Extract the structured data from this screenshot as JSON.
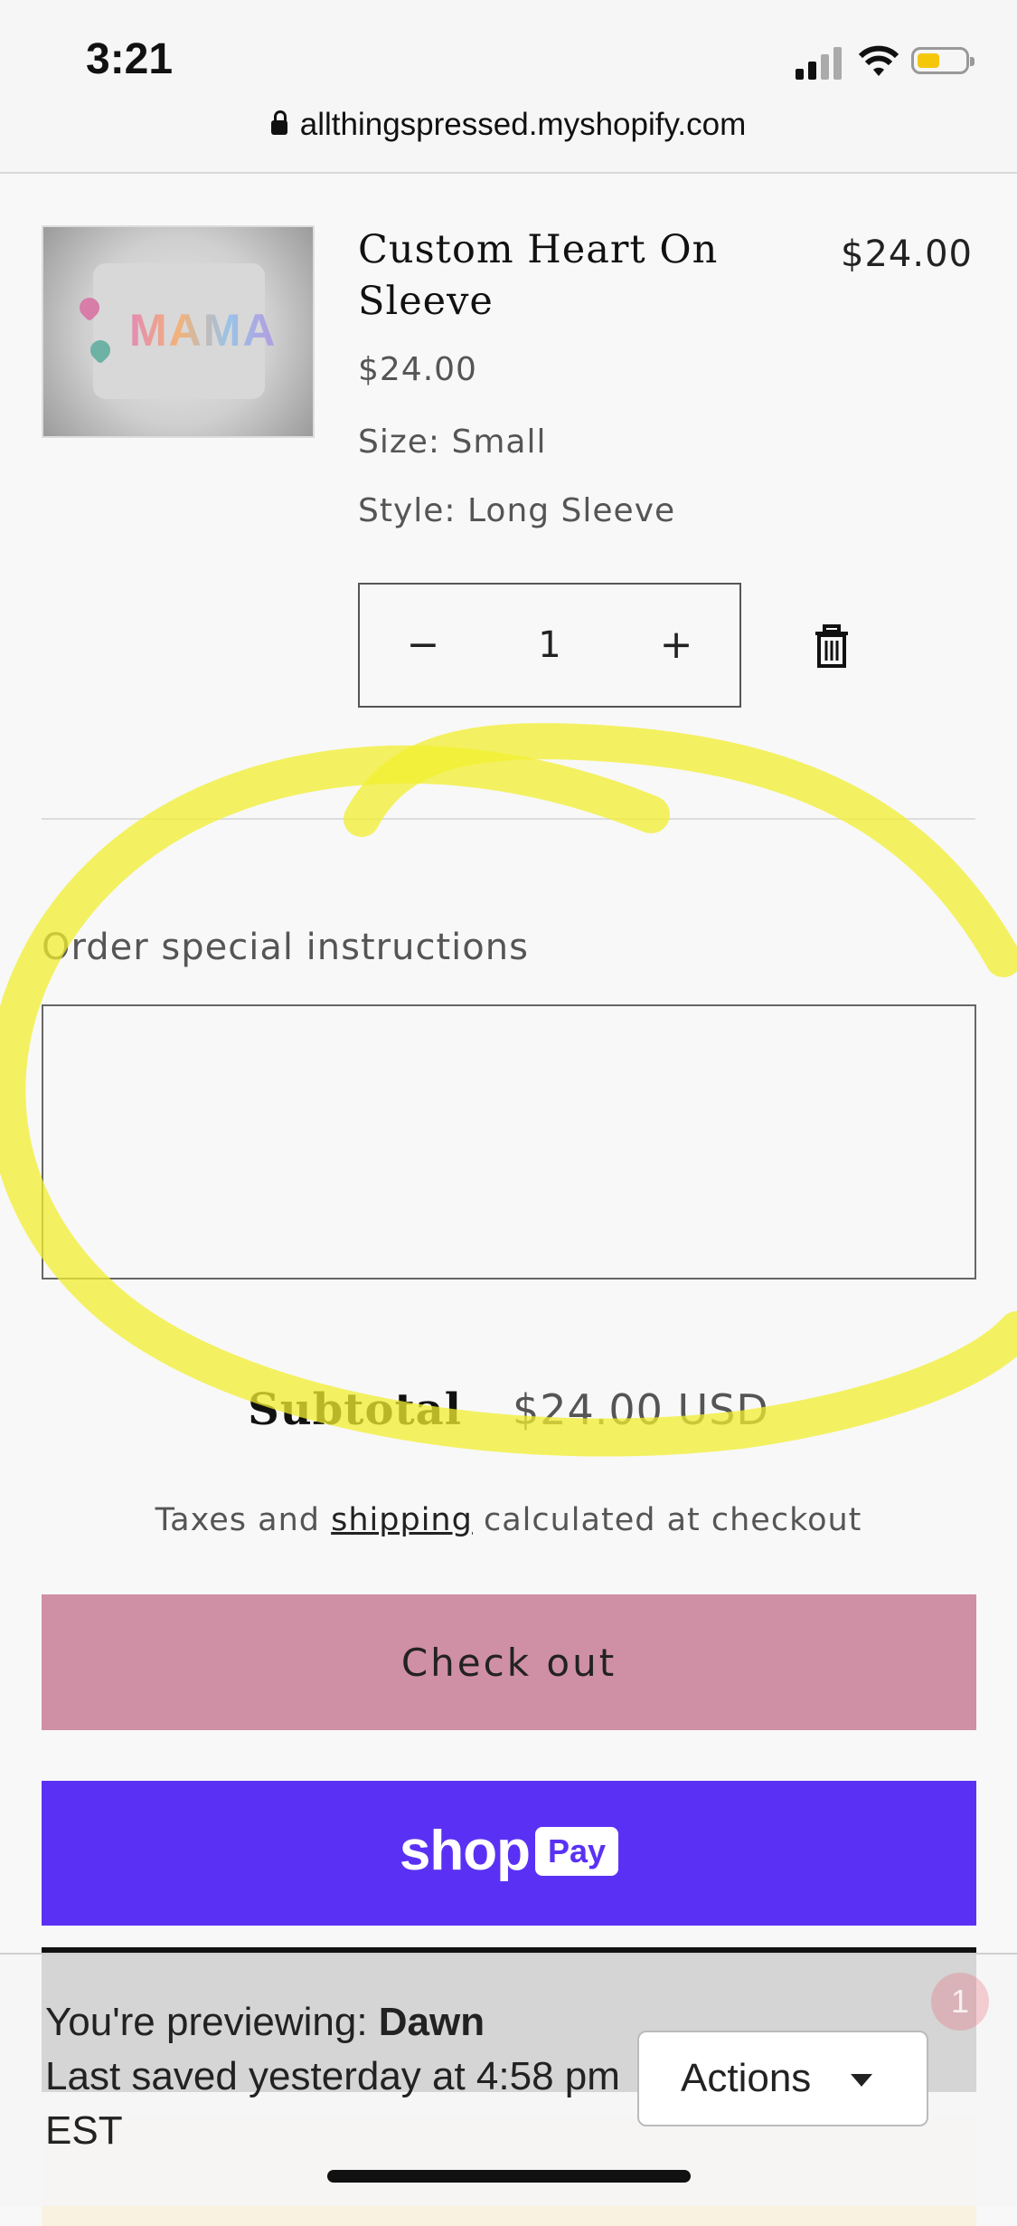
{
  "status_bar": {
    "time": "3:21",
    "url": "allthingspressed.myshopify.com"
  },
  "cart_item": {
    "title": "Custom Heart On Sleeve",
    "line_price": "$24.00",
    "unit_price": "$24.00",
    "size": "Size: Small",
    "style": "Style: Long Sleeve",
    "quantity": "1",
    "minus_symbol": "−",
    "plus_symbol": "+",
    "image_text": "MAMA"
  },
  "instructions": {
    "label": "Order special instructions",
    "value": ""
  },
  "summary": {
    "subtotal_label": "Subtotal",
    "subtotal_value": "$24.00 USD",
    "taxes_prefix": "Taxes and ",
    "taxes_link": "shipping",
    "taxes_suffix": " calculated at checkout"
  },
  "buttons": {
    "checkout": "Check out",
    "shop_pay_word": "shop",
    "shop_pay_badge": "Pay"
  },
  "preview_bar": {
    "previewing_prefix": "You're previewing: ",
    "theme_name": "Dawn",
    "last_saved": "Last saved yesterday at 4:58 pm EST",
    "actions_label": "Actions",
    "notification_count": "1"
  },
  "colors": {
    "checkout": "#cf8fa4",
    "shop_pay": "#5a31f4",
    "highlight": "#f2ef2f"
  }
}
